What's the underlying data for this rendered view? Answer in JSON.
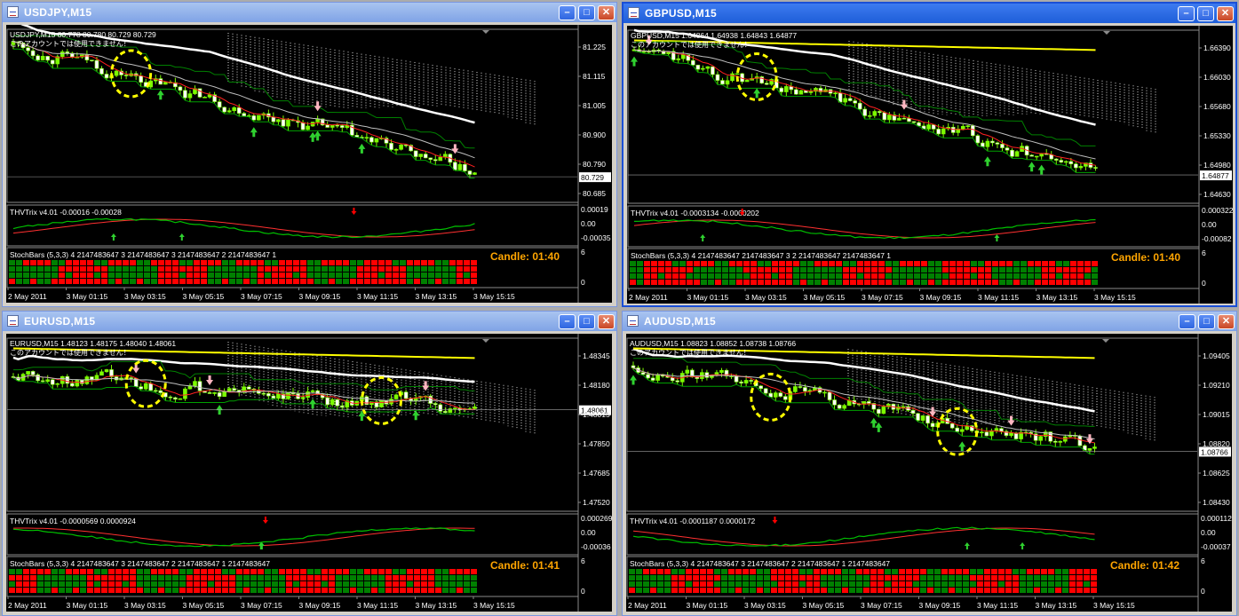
{
  "windows": [
    {
      "title": "USDJPY,M15",
      "active": false,
      "price_label": "USDJPY,M15  80.778 80.780 80.729 80.729",
      "account_note": "このアカウントでは使用できません！",
      "price_axis": [
        "81.225",
        "81.115",
        "81.005",
        "80.900",
        "80.790",
        "80.685"
      ],
      "current_price": "80.729",
      "trix_label": "THVTrix v4.01 -0.00016 -0.00028",
      "trix_axis": [
        "0.00019",
        "0.00",
        "-0.00035"
      ],
      "stoch_label": "StochBars (5,3,3) 4 2147483647 3 2147483647 3 2147483647 2 2147483647 1",
      "stoch_axis": [
        "6",
        "0"
      ],
      "candle_timer": "Candle:  01:40",
      "time_axis": [
        "2 May 2011",
        "3 May 01:15",
        "3 May 03:15",
        "3 May 05:15",
        "3 May 07:15",
        "3 May 09:15",
        "3 May 11:15",
        "3 May 13:15",
        "3 May 15:15"
      ],
      "chart_data": {
        "type": "candlestick",
        "open": 81.26,
        "close": 80.74,
        "min": 80.66,
        "max": 81.3
      },
      "highlight_markers": 1
    },
    {
      "title": "GBPUSD,M15",
      "active": true,
      "price_label": "GBPUSD,M15  1.64864 1.64938 1.64843 1.64877",
      "account_note": "このアカウントでは使用できません！",
      "price_axis": [
        "1.66390",
        "1.66030",
        "1.65680",
        "1.65330",
        "1.64980",
        "1.64630"
      ],
      "current_price": "1.64877",
      "trix_label": "THVTrix v4.01 -0.0003134 -0.0000202",
      "trix_axis": [
        "0.000322",
        "0.00",
        "-0.00082"
      ],
      "stoch_label": "StochBars (5,3,3) 4 2147483647 2147483647 3 2 2147483647 2147483647 1",
      "stoch_axis": [
        "6",
        "0"
      ],
      "candle_timer": "Candle:  01:40",
      "time_axis": [
        "2 May 2011",
        "3 May 01:15",
        "3 May 03:15",
        "3 May 05:15",
        "3 May 07:15",
        "3 May 09:15",
        "3 May 11:15",
        "3 May 13:15",
        "3 May 15:15"
      ],
      "chart_data": {
        "type": "candlestick",
        "open": 1.665,
        "close": 1.6488,
        "min": 1.6458,
        "max": 1.667
      },
      "highlight_markers": 1
    },
    {
      "title": "EURUSD,M15",
      "active": false,
      "price_label": "EURUSD,M15  1.48123 1.48175 1.48040 1.48061",
      "account_note": "このアカウントでは使用できません！",
      "price_axis": [
        "1.48345",
        "1.48180",
        "1.48015",
        "1.47850",
        "1.47685",
        "1.47520"
      ],
      "current_price": "1.48061",
      "trix_label": "THVTrix v4.01 -0.0000569 0.0000924",
      "trix_axis": [
        "0.000269",
        "0.00",
        "-0.00036"
      ],
      "stoch_label": "StochBars (5,3,3) 4 2147483647 3 2147483647 2 2147483647 1 2147483647",
      "stoch_axis": [
        "6",
        "0"
      ],
      "candle_timer": "Candle:  01:41",
      "time_axis": [
        "2 May 2011",
        "3 May 01:15",
        "3 May 03:15",
        "3 May 05:15",
        "3 May 07:15",
        "3 May 09:15",
        "3 May 11:15",
        "3 May 13:15",
        "3 May 15:15"
      ],
      "chart_data": {
        "type": "candlestick",
        "open": 1.4826,
        "close": 1.4806,
        "min": 1.4748,
        "max": 1.4846
      },
      "highlight_markers": 2
    },
    {
      "title": "AUDUSD,M15",
      "active": false,
      "price_label": "AUDUSD,M15  1.08823 1.08852 1.08738 1.08766",
      "account_note": "このアカウントでは使用できません！",
      "price_axis": [
        "1.09405",
        "1.09210",
        "1.09015",
        "1.08820",
        "1.08625",
        "1.08430"
      ],
      "current_price": "1.08766",
      "trix_label": "THVTrix v4.01 -0.0001187 0.0000172",
      "trix_axis": [
        "0.000112",
        "0.00",
        "-0.00037"
      ],
      "stoch_label": "StochBars (5,3,3) 4 2147483647 3 2147483647 2 2147483647 1 2147483647",
      "stoch_axis": [
        "6",
        "0"
      ],
      "candle_timer": "Candle:  01:42",
      "time_axis": [
        "2 May 2011",
        "3 May 01:15",
        "3 May 03:15",
        "3 May 05:15",
        "3 May 07:15",
        "3 May 09:15",
        "3 May 11:15",
        "3 May 13:15",
        "3 May 15:15"
      ],
      "chart_data": {
        "type": "candlestick",
        "open": 1.0935,
        "close": 1.0877,
        "min": 1.084,
        "max": 1.095
      },
      "highlight_markers": 2
    }
  ],
  "colors": {
    "bull": "#7cfc00",
    "bear": "#ffffff",
    "signal_up": "#2fd12f",
    "signal_down": "#ffb6c1",
    "highlight": "#ffff00",
    "candle_text": "#ffa500",
    "trix_fast": "#00c000",
    "trix_slow": "#ff3030",
    "stoch_up": "#008000",
    "stoch_down": "#ff0000"
  }
}
